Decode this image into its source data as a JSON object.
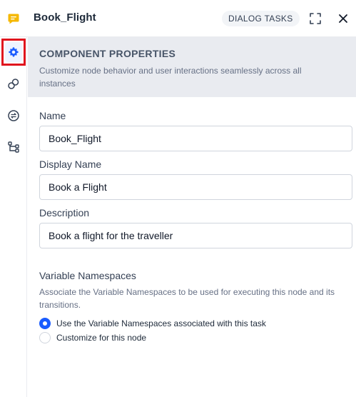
{
  "header": {
    "title": "Book_Flight",
    "badge": "DIALOG TASKS",
    "icons": {
      "app": "chat-bubble-icon",
      "expand": "expand-icon",
      "close": "close-icon"
    }
  },
  "rail": {
    "items": [
      {
        "icon": "gear-icon",
        "active": true
      },
      {
        "icon": "link-icon",
        "active": false
      },
      {
        "icon": "transfer-icon",
        "active": false
      },
      {
        "icon": "flow-icon",
        "active": false
      }
    ]
  },
  "section": {
    "title": "COMPONENT PROPERTIES",
    "description": "Customize node behavior and user interactions seamlessly across all instances"
  },
  "fields": {
    "name": {
      "label": "Name",
      "value": "Book_Flight"
    },
    "display_name": {
      "label": "Display Name",
      "value": "Book a Flight"
    },
    "description": {
      "label": "Description",
      "value": "Book a flight for the traveller"
    }
  },
  "namespaces": {
    "title": "Variable Namespaces",
    "description": "Associate the Variable Namespaces to be used for executing this node and its transitions.",
    "options": [
      {
        "label": "Use the Variable Namespaces associated with this task",
        "selected": true
      },
      {
        "label": "Customize for this node",
        "selected": false
      }
    ]
  },
  "colors": {
    "accent": "#1a5cff",
    "app_icon": "#f5b800",
    "highlight_border": "#e0141e",
    "section_bg": "#e9ebf0"
  }
}
